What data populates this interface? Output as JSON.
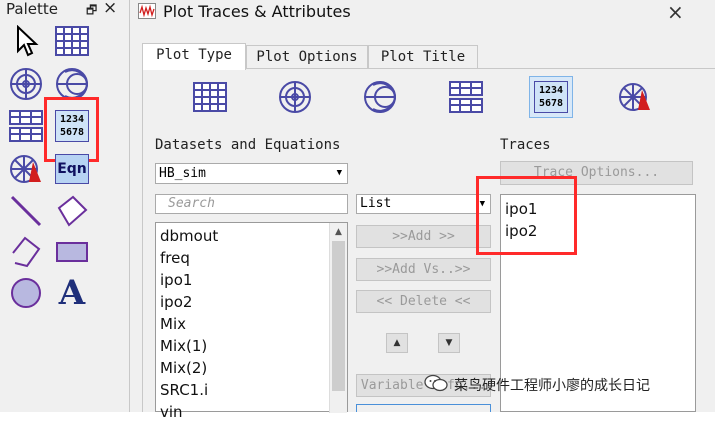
{
  "palette": {
    "title": "Palette",
    "pin_glyph": "🗗",
    "close_glyph": "×",
    "tools": [
      {
        "name": "pointer-icon"
      },
      {
        "name": "rectangular-grid-icon"
      },
      {
        "name": "polar-plot-icon"
      },
      {
        "name": "smith-chart-icon"
      },
      {
        "name": "stacked-grid-icon"
      },
      {
        "name": "list-1234-5678-icon",
        "text": [
          "1234",
          "5678"
        ]
      },
      {
        "name": "antenna-plot-icon"
      },
      {
        "name": "equation-icon",
        "text": [
          "Eqn"
        ]
      },
      {
        "name": "line-tool-icon"
      },
      {
        "name": "polygon-tool-icon"
      },
      {
        "name": "polyline-tool-icon"
      },
      {
        "name": "rectangle-tool-icon"
      },
      {
        "name": "circle-tool-icon"
      },
      {
        "name": "text-tool-icon",
        "text": [
          "A"
        ]
      }
    ]
  },
  "dialog": {
    "title": "Plot Traces & Attributes",
    "close_glyph": "×",
    "tabs": [
      {
        "label": "Plot Type",
        "active": true
      },
      {
        "label": "Plot Options",
        "active": false
      },
      {
        "label": "Plot Title",
        "active": false
      }
    ],
    "plot_types": [
      {
        "name": "rectangular-plot-icon"
      },
      {
        "name": "polar-plot-icon"
      },
      {
        "name": "smith-chart-icon"
      },
      {
        "name": "stacked-plot-icon"
      },
      {
        "name": "list-plot-icon",
        "text": [
          "1234",
          "5678"
        ],
        "selected": true
      },
      {
        "name": "antenna-plot-icon"
      }
    ],
    "datasets_label": "Datasets and Equations",
    "dataset_value": "HB_sim",
    "search_placeholder": "Search",
    "list_mode_value": "List",
    "variables": [
      "dbmout",
      "freq",
      "ipo1",
      "ipo2",
      "Mix",
      "Mix(1)",
      "Mix(2)",
      "SRC1.i",
      "vin"
    ],
    "buttons": {
      "add": ">>Add >>",
      "add_vs": ">>Add Vs..>>",
      "delete": "<< Delete <<",
      "variable_info": "Variable Info..."
    },
    "traces_label": "Traces",
    "trace_options": "Trace Options...",
    "traces": [
      "ipo1",
      "ipo2"
    ]
  },
  "watermark": "菜鸟硬件工程师小廖的成长日记",
  "colors": {
    "highlight": "#ff2a2a",
    "icon_blue": "#4a4aa6",
    "icon_purple": "#6a2f9c"
  }
}
